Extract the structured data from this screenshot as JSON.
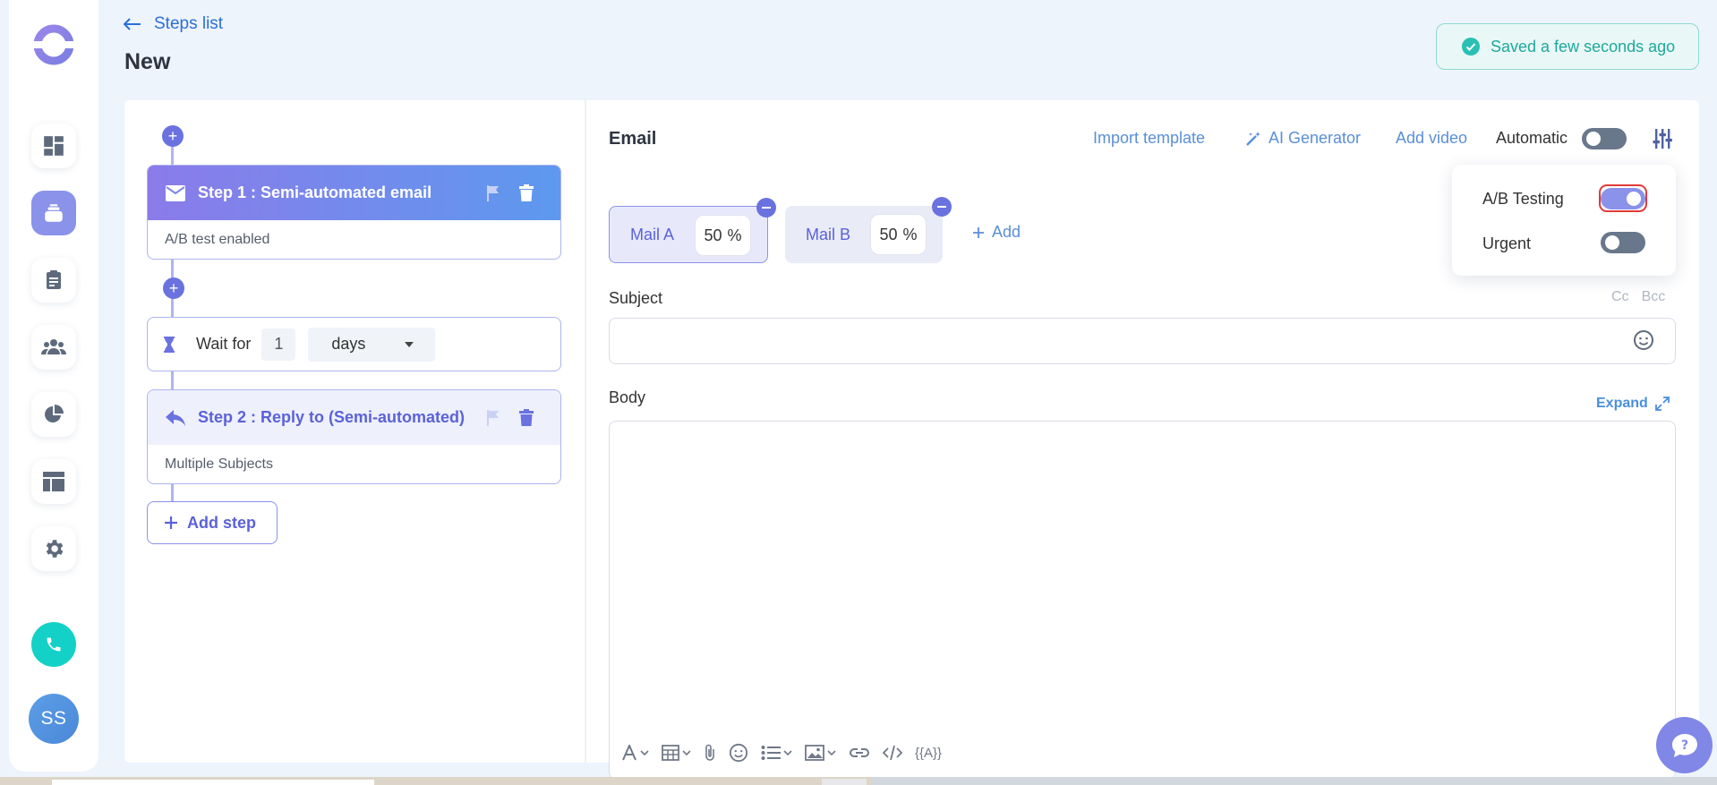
{
  "header": {
    "back_label": "Steps list",
    "page_title": "New",
    "saved_status": "Saved a few seconds ago"
  },
  "sidebar": {
    "items": [
      {
        "icon": "dashboard-icon"
      },
      {
        "icon": "sequences-icon",
        "active": true
      },
      {
        "icon": "clipboard-icon"
      },
      {
        "icon": "users-icon"
      },
      {
        "icon": "pie-chart-icon"
      },
      {
        "icon": "layout-icon"
      },
      {
        "icon": "gear-icon"
      }
    ],
    "avatar_initials": "SS"
  },
  "steps": {
    "step1": {
      "title": "Step 1 : Semi-automated email",
      "subtitle": "A/B test enabled"
    },
    "wait": {
      "label": "Wait for",
      "value": "1",
      "unit": "days"
    },
    "step2": {
      "title": "Step 2 : Reply to (Semi-automated)",
      "subtitle": "Multiple Subjects"
    },
    "add_step": "Add step"
  },
  "email": {
    "title": "Email",
    "import_template": "Import template",
    "ai_generator": "AI Generator",
    "add_video": "Add video",
    "automatic": "Automatic",
    "options": {
      "ab_testing": "A/B Testing",
      "urgent": "Urgent"
    },
    "mails": [
      {
        "label": "Mail A",
        "percent": "50",
        "unit": "%"
      },
      {
        "label": "Mail B",
        "percent": "50",
        "unit": "%"
      }
    ],
    "add_mail": "Add",
    "subject_label": "Subject",
    "cc": "Cc",
    "bcc": "Bcc",
    "subject_value": "",
    "body_label": "Body",
    "expand": "Expand",
    "variable_token": "{{A}}"
  },
  "colors": {
    "accent": "#8a92ea",
    "primary_text_link": "#2a6fd6",
    "success": "#1ea89d",
    "call": "#13d1c6"
  }
}
